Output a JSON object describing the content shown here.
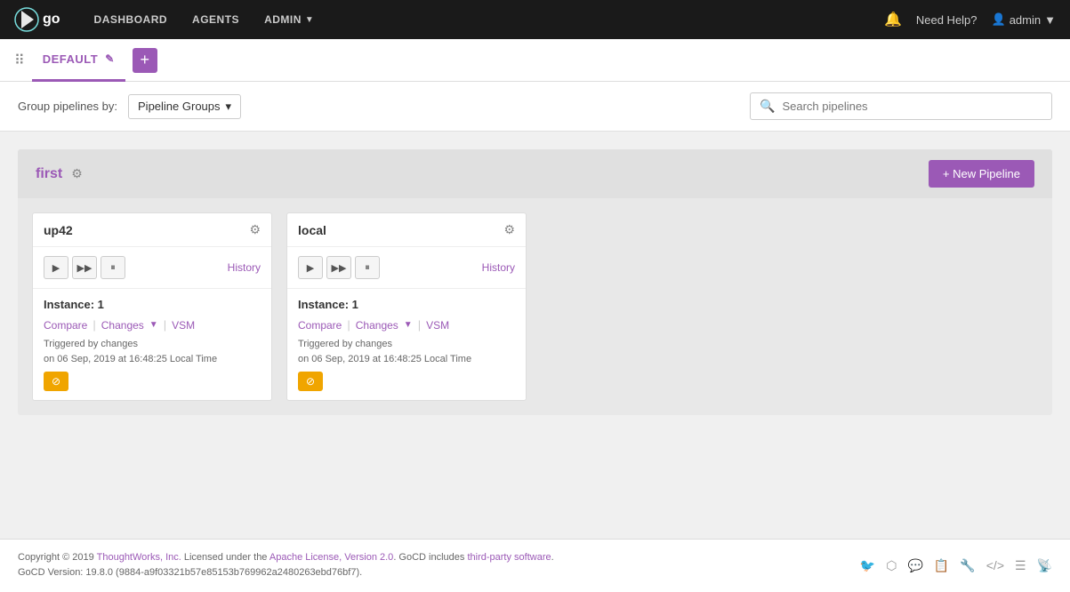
{
  "topnav": {
    "logo_text": "go",
    "links": [
      {
        "label": "DASHBOARD",
        "id": "dashboard"
      },
      {
        "label": "AGENTS",
        "id": "agents"
      },
      {
        "label": "ADMIN",
        "id": "admin",
        "has_arrow": true
      }
    ],
    "bell_label": "Notifications",
    "help_text": "Need Help?",
    "user_text": "admin",
    "user_arrow": "▼"
  },
  "tabs": {
    "dots_label": "⠿",
    "active_tab": "DEFAULT",
    "edit_icon": "✎",
    "add_icon": "+"
  },
  "toolbar": {
    "group_label": "Group pipelines by:",
    "group_select": "Pipeline Groups",
    "search_placeholder": "Search pipelines"
  },
  "pipeline_group": {
    "title": "first",
    "new_pipeline_label": "+ New Pipeline",
    "pipelines": [
      {
        "id": "up42",
        "name": "up42",
        "instance_label": "Instance: 1",
        "compare_text": "Compare",
        "changes_text": "Changes",
        "vsm_text": "VSM",
        "history_text": "History",
        "trigger_line1": "Triggered by changes",
        "trigger_line2": "on 06 Sep, 2019 at 16:48:25 Local Time",
        "status_icon": "⊘"
      },
      {
        "id": "local",
        "name": "local",
        "instance_label": "Instance: 1",
        "compare_text": "Compare",
        "changes_text": "Changes",
        "vsm_text": "VSM",
        "history_text": "History",
        "trigger_line1": "Triggered by changes",
        "trigger_line2": "on 06 Sep, 2019 at 16:48:25 Local Time",
        "status_icon": "⊘"
      }
    ]
  },
  "footer": {
    "copyright": "Copyright © 2019 ",
    "thoughtworks": "ThoughtWorks, Inc.",
    "license_text": " Licensed under the ",
    "license_link_text": "Apache License, Version 2.0",
    "gocd_text": ". GoCD includes ",
    "third_party_text": "third-party software",
    "period": ".",
    "version_text": "GoCD Version: 19.8.0 (9884-a9f03321b57e85153b769962a2480263ebd76bf7).",
    "icons": [
      "🐦",
      "🐙",
      "💬",
      "📋",
      "🔧",
      "⟨⟩",
      "☰",
      "📡"
    ]
  },
  "colors": {
    "accent": "#9b59b6",
    "nav_bg": "#1a1a1a",
    "status_yellow": "#f0a500"
  }
}
